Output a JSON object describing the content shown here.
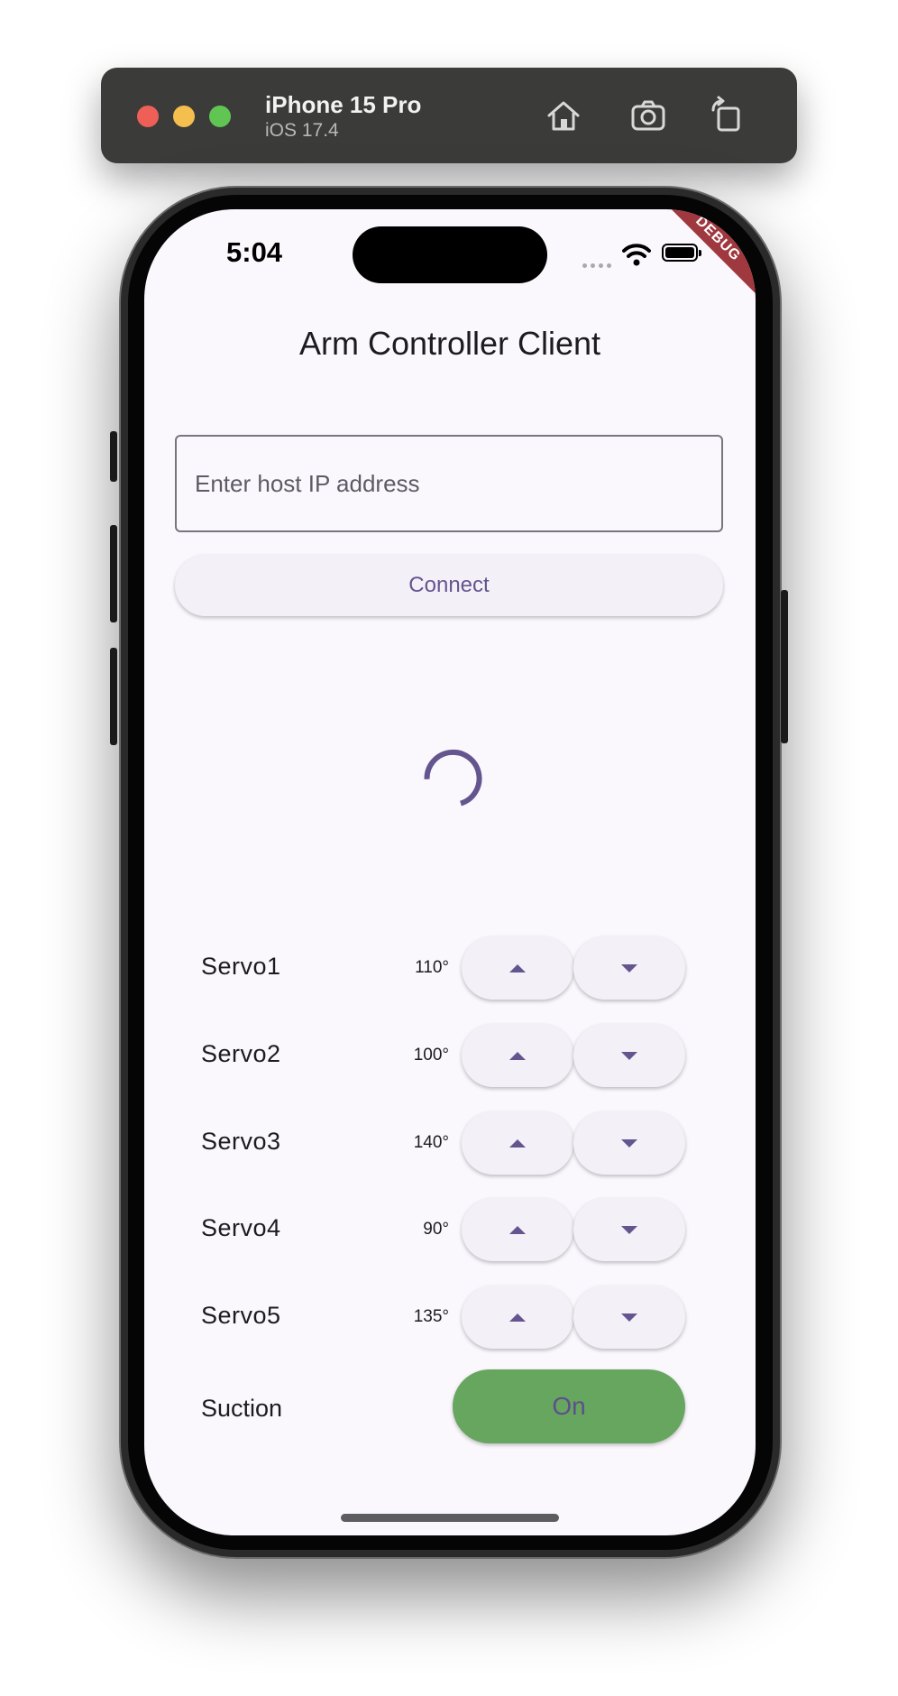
{
  "simulator": {
    "device_name": "iPhone 15 Pro",
    "os_version": "iOS 17.4",
    "icons": [
      "home-icon",
      "screenshot-icon",
      "rotate-icon"
    ]
  },
  "status_bar": {
    "time": "5:04"
  },
  "debug_banner": "DEBUG",
  "app": {
    "title": "Arm Controller Client",
    "host_field": {
      "placeholder": "Enter host IP address",
      "value": ""
    },
    "connect_label": "Connect",
    "loading": true,
    "servos": [
      {
        "label": "Servo1",
        "angle": "110°"
      },
      {
        "label": "Servo2",
        "angle": "100°"
      },
      {
        "label": "Servo3",
        "angle": "140°"
      },
      {
        "label": "Servo4",
        "angle": "90°"
      },
      {
        "label": "Servo5",
        "angle": "135°"
      }
    ],
    "suction": {
      "label": "Suction",
      "button_label": "On"
    }
  },
  "colors": {
    "accent": "#65558f",
    "suction_on": "#66a65f",
    "background": "#fbf8fd",
    "debug_ribbon": "#a0383f"
  }
}
